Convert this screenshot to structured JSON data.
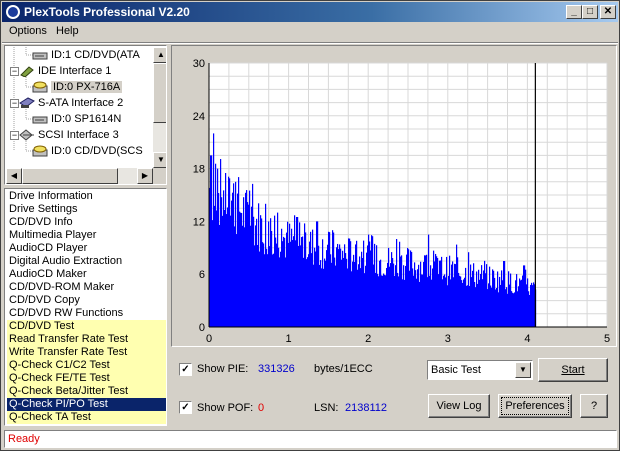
{
  "window": {
    "title": "PlexTools Professional V2.20",
    "minimize": "_",
    "maximize": "□",
    "close": "✕"
  },
  "menu": {
    "options": "Options",
    "help": "Help"
  },
  "tree": [
    {
      "label": "ID:1  CD/DVD(ATA",
      "icon": "drive-icon"
    },
    {
      "label": "IDE Interface 1",
      "icon": "ide-interface-icon"
    },
    {
      "label": "ID:0  PX-716A",
      "icon": "cd-drive-icon",
      "selected": true
    },
    {
      "label": "S-ATA Interface 2",
      "icon": "sata-interface-icon"
    },
    {
      "label": "ID:0  SP1614N",
      "icon": "drive-icon"
    },
    {
      "label": "SCSI Interface 3",
      "icon": "scsi-interface-icon"
    },
    {
      "label": "ID:0  CD/DVD(SCS",
      "icon": "cd-drive-icon"
    }
  ],
  "functions": [
    {
      "label": "Drive Information",
      "style": "white"
    },
    {
      "label": "Drive Settings",
      "style": "white"
    },
    {
      "label": "CD/DVD Info",
      "style": "white"
    },
    {
      "label": "Multimedia Player",
      "style": "white"
    },
    {
      "label": "AudioCD Player",
      "style": "white"
    },
    {
      "label": "Digital Audio Extraction",
      "style": "white"
    },
    {
      "label": "AudioCD Maker",
      "style": "white"
    },
    {
      "label": "CD/DVD-ROM Maker",
      "style": "white"
    },
    {
      "label": "CD/DVD Copy",
      "style": "white"
    },
    {
      "label": "CD/DVD RW Functions",
      "style": "white"
    },
    {
      "label": "CD/DVD Test",
      "style": "yellow"
    },
    {
      "label": "Read Transfer Rate Test",
      "style": "yellow"
    },
    {
      "label": "Write Transfer Rate Test",
      "style": "yellow"
    },
    {
      "label": "Q-Check C1/C2 Test",
      "style": "yellow"
    },
    {
      "label": "Q-Check FE/TE Test",
      "style": "yellow"
    },
    {
      "label": "Q-Check Beta/Jitter Test",
      "style": "yellow"
    },
    {
      "label": "Q-Check PI/PO Test",
      "style": "selected"
    },
    {
      "label": "Q-Check TA Test",
      "style": "yellow"
    }
  ],
  "controls": {
    "show_pie_label": "Show PIE:",
    "pie_value": "331326",
    "pie_unit": "bytes/1ECC",
    "show_pof_label": "Show POF:",
    "pof_value": "0",
    "lsn_label": "LSN:",
    "lsn_value": "2138112",
    "test_mode": "Basic Test",
    "start_button": "Start",
    "viewlog_button": "View Log",
    "preferences_button": "Preferences",
    "help_button": "?",
    "show_pie_checked": true,
    "show_pof_checked": true
  },
  "status": {
    "text": "Ready"
  },
  "colors": {
    "bar": "#0000ff",
    "cursor_line": "#000000",
    "pie_value": "#0000cc",
    "pof_value": "#e00000",
    "status_text": "#e00000",
    "highlight_yellow": "#ffffb0",
    "selection": "#0a246a"
  },
  "chart_data": {
    "type": "bar",
    "title": "",
    "xlabel": "",
    "ylabel": "",
    "xlim": [
      0,
      5
    ],
    "ylim": [
      0,
      30
    ],
    "x_ticks": [
      "0",
      "1",
      "2",
      "3",
      "4",
      "5"
    ],
    "y_ticks": [
      "0",
      "6",
      "12",
      "18",
      "24",
      "30"
    ],
    "grid": true,
    "cursor_x": 4.1,
    "envelope": [
      {
        "x": 0.0,
        "y": 15.5
      },
      {
        "x": 0.1,
        "y": 15.0
      },
      {
        "x": 0.25,
        "y": 14.5
      },
      {
        "x": 0.5,
        "y": 12.0
      },
      {
        "x": 0.75,
        "y": 10.5
      },
      {
        "x": 1.0,
        "y": 9.5
      },
      {
        "x": 1.25,
        "y": 9.0
      },
      {
        "x": 1.5,
        "y": 8.5
      },
      {
        "x": 1.75,
        "y": 8.0
      },
      {
        "x": 2.0,
        "y": 7.5
      },
      {
        "x": 2.5,
        "y": 7.0
      },
      {
        "x": 3.0,
        "y": 6.3
      },
      {
        "x": 3.5,
        "y": 5.5
      },
      {
        "x": 4.0,
        "y": 4.5
      },
      {
        "x": 4.1,
        "y": 4.0
      }
    ],
    "peaks": [
      {
        "x": 0.02,
        "y": 19.5
      },
      {
        "x": 0.05,
        "y": 22.0
      },
      {
        "x": 0.1,
        "y": 18.0
      },
      {
        "x": 0.2,
        "y": 17.5
      },
      {
        "x": 0.33,
        "y": 16.5
      },
      {
        "x": 0.5,
        "y": 15.5
      },
      {
        "x": 0.7,
        "y": 14.0
      },
      {
        "x": 0.85,
        "y": 13.0
      },
      {
        "x": 1.1,
        "y": 12.5
      },
      {
        "x": 1.35,
        "y": 12.0
      },
      {
        "x": 1.55,
        "y": 11.0
      },
      {
        "x": 2.0,
        "y": 10.5
      },
      {
        "x": 2.35,
        "y": 10.0
      },
      {
        "x": 2.75,
        "y": 10.5
      },
      {
        "x": 3.25,
        "y": 8.5
      },
      {
        "x": 3.7,
        "y": 7.5
      },
      {
        "x": 3.95,
        "y": 7.0
      }
    ]
  }
}
